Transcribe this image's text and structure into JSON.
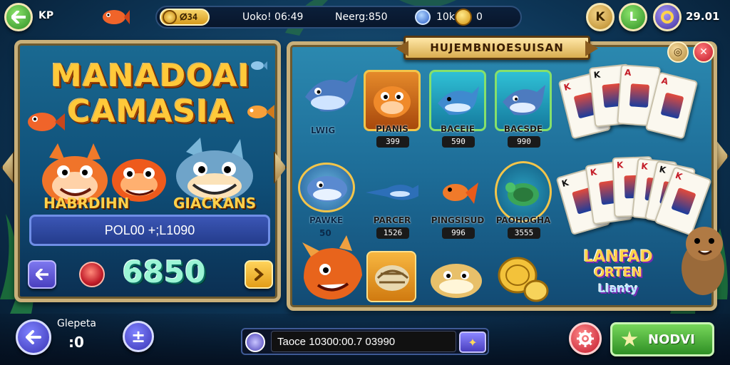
{
  "topbar": {
    "kp_label": "KP",
    "coin_tag": "ⵁ34",
    "stat_1": "Uoko! 06:49",
    "stat_2": "Neerg:850",
    "stat_3": "10k",
    "stat_4": "0",
    "score": "29.01",
    "k_label": "K",
    "l_label": "L",
    "colors": {
      "green": "#2f8f25",
      "gold": "#d69a1c",
      "purple": "#3f2f9c"
    }
  },
  "left_panel": {
    "title_line1": "MANADOAI",
    "title_line2": "CAMASIA",
    "char_left": "HABRDIHN",
    "char_right": "GIACKANS",
    "pool_text": "POL00 +;L1090",
    "big_score": "6850"
  },
  "right_panel": {
    "banner": "HUJEMBNIOESUISAN",
    "info_icon": "coin-info-icon",
    "close_icon": "x-icon",
    "side_fish": [
      {
        "name": "LWIG",
        "price": ""
      },
      {
        "name": "PAWKE",
        "price": "50"
      }
    ],
    "fish": [
      {
        "name": "PIANIS",
        "price": "399"
      },
      {
        "name": "BACEIE",
        "price": "590"
      },
      {
        "name": "BACSDE",
        "price": "990"
      },
      {
        "name": "PARCER",
        "price": "1526"
      },
      {
        "name": "PINGSISUD",
        "price": "996"
      },
      {
        "name": "PAOHOGHA",
        "price": "3555"
      }
    ],
    "cards_top": [
      "K",
      "K",
      "A",
      "A"
    ],
    "cards_bottom": [
      "K",
      "K",
      "K",
      "K",
      "K",
      "K"
    ],
    "logo_line1": "LANFAD",
    "logo_line2": "ORTEN",
    "logo_line3": "Llanty"
  },
  "bottombar": {
    "label": "Glepeta",
    "count": ":0",
    "bet_text": "Taoce 10300:00.7 03990",
    "play_label": "NODVI",
    "colors": {
      "play": "#2f8f25",
      "settings": "#c2182b"
    }
  }
}
